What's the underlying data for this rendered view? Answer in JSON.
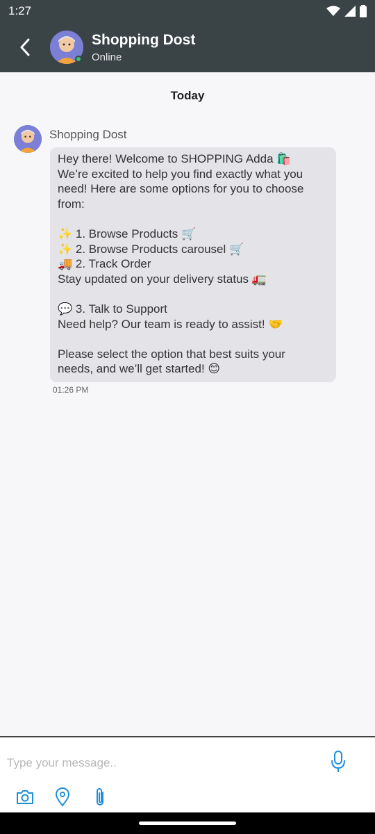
{
  "status_bar": {
    "time": "1:27"
  },
  "header": {
    "title": "Shopping Dost",
    "status": "Online"
  },
  "chat": {
    "date_label": "Today",
    "message": {
      "sender": "Shopping Dost",
      "lines": [
        "Hey there! Welcome to SHOPPING Adda 🛍️",
        "We’re excited to help you find exactly what you",
        "need! Here are some options for you to choose",
        "from:",
        "",
        "✨ 1. Browse Products 🛒",
        "✨ 2. Browse Products carousel 🛒",
        "🚚 2. Track Order",
        "Stay updated on your delivery status 🚛",
        "",
        "💬 3. Talk to Support",
        "Need help? Our team is ready to assist! 🤝",
        "",
        "Please select the option that best suits your",
        "needs, and we’ll get started! 😊"
      ],
      "time": "01:26 PM"
    }
  },
  "composer": {
    "placeholder": "Type your message..",
    "icons": [
      "camera-icon",
      "location-icon",
      "attachment-icon",
      "microphone-icon"
    ]
  },
  "colors": {
    "header_bg": "#3a4446",
    "bubble_bg": "#e3e3e8",
    "accent": "#1f8fd8",
    "online": "#35c46a"
  }
}
